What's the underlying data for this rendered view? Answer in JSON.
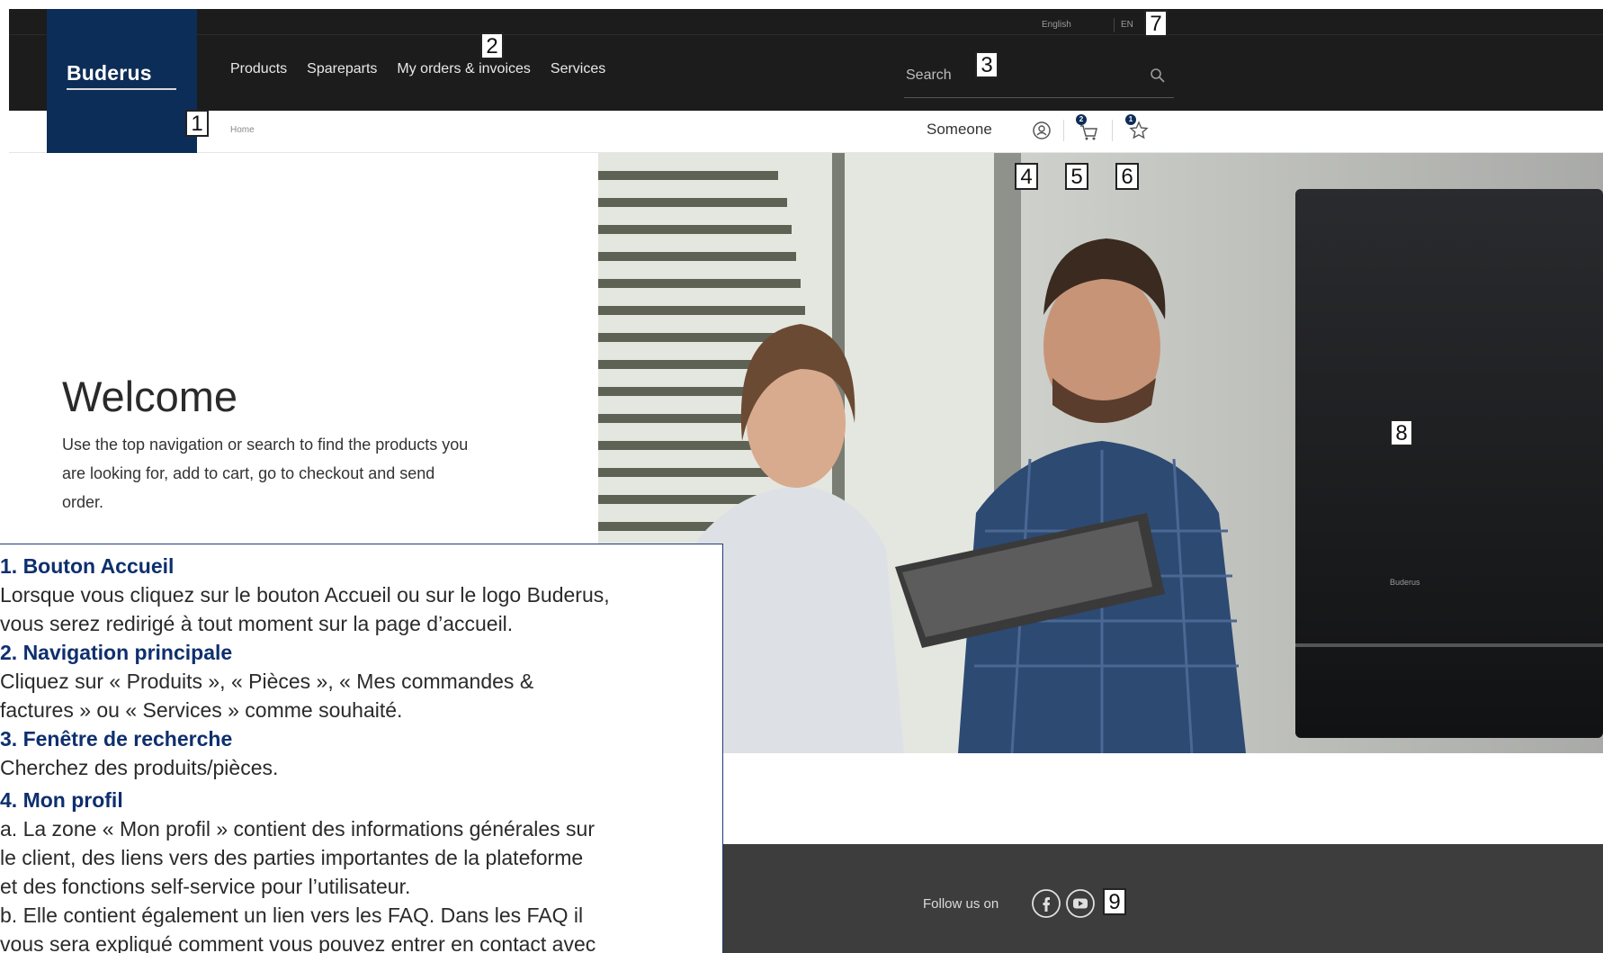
{
  "header": {
    "logo": "Buderus",
    "language_label": "English",
    "language_code": "EN",
    "nav_items": [
      {
        "label": "Products"
      },
      {
        "label": "Spareparts"
      },
      {
        "label": "My orders & invoices"
      },
      {
        "label": "Services"
      }
    ],
    "search_placeholder": "Search"
  },
  "subbar": {
    "breadcrumb": "Home",
    "user_name": "Someone",
    "cart_badge": "2",
    "wishlist_badge": "1"
  },
  "main": {
    "welcome_title": "Welcome",
    "welcome_lines": [
      "Use the top navigation or search to find the products you",
      "are looking for, add to cart, go to checkout and send",
      "order."
    ],
    "hero_brand": "Buderus"
  },
  "footer": {
    "follow_label": "Follow us on",
    "social": [
      "facebook-icon",
      "youtube-icon"
    ]
  },
  "markers": [
    "1",
    "2",
    "3",
    "4",
    "5",
    "6",
    "7",
    "8",
    "9"
  ],
  "help": {
    "s1_title": "1.    Bouton Accueil",
    "s1_l1": "Lorsque vous cliquez sur le bouton Accueil ou sur le logo Buderus,",
    "s1_l2": "vous serez redirigé à tout moment sur la page d’accueil.",
    "s2_title": "2.    Navigation principale",
    "s2_l1": "Cliquez sur « Produits », « Pièces », « Mes commandes &",
    "s2_l2": "factures » ou « Services » comme souhaité.",
    "s3_title": "3.    Fenêtre de recherche",
    "s3_l1": "Cherchez des produits/pièces.",
    "s4_title": "4. Mon profil",
    "s4_l1": "a. La zone « Mon profil » contient des informations générales sur",
    "s4_l2": "le client, des liens vers des parties importantes de la plateforme",
    "s4_l3": "et des fonctions self-service pour l’utilisateur.",
    "s4_l4": "b. Elle contient également un lien vers les FAQ. Dans les FAQ il",
    "s4_l5": "vous sera expliqué comment vous pouvez entrer en contact avec"
  },
  "colors": {
    "header_bg": "#1c1c1c",
    "brand_blue": "#0c2d57",
    "footer_bg": "#3d3d3d",
    "help_heading": "#0e2f6e"
  }
}
